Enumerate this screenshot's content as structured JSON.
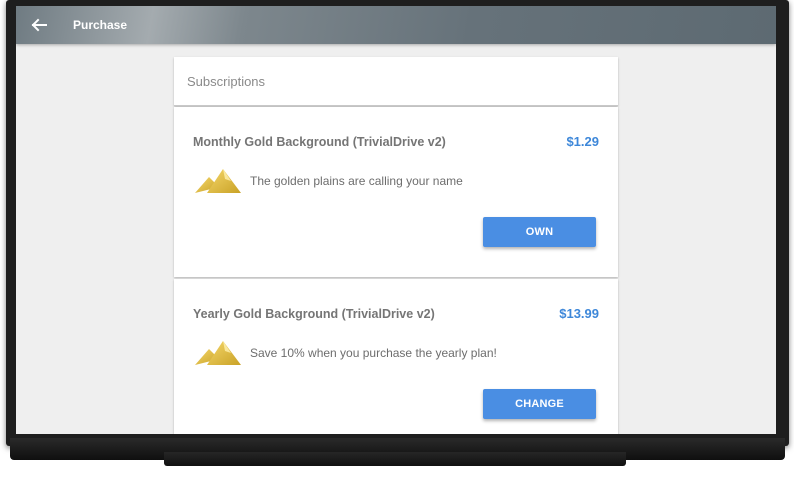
{
  "appbar": {
    "title": "Purchase",
    "back_icon": "arrow-back-icon"
  },
  "section": {
    "title": "Subscriptions"
  },
  "items": [
    {
      "title": "Monthly Gold Background (TrivialDrive v2)",
      "price": "$1.29",
      "description": "The golden plains are calling your name",
      "button_label": "OWN",
      "icon": "gold-mountains-icon"
    },
    {
      "title": "Yearly Gold Background (TrivialDrive v2)",
      "price": "$13.99",
      "description": "Save 10% when you purchase the yearly plan!",
      "button_label": "CHANGE",
      "icon": "gold-mountains-icon"
    }
  ],
  "colors": {
    "accent": "#4a8ee3",
    "price": "#3d87d9",
    "appbar": "#66727a"
  }
}
